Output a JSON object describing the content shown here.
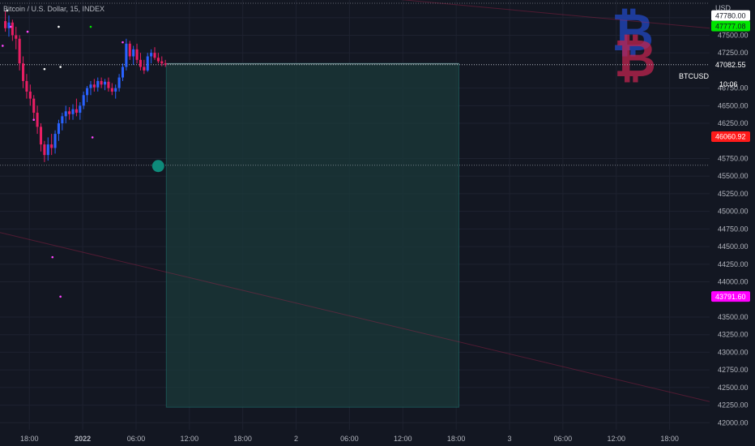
{
  "header": {
    "title": "Bitcoin / U.S. Dollar, 15, INDEX",
    "currency": "USD"
  },
  "chart_data": {
    "type": "candlestick",
    "symbol_label": "BTCUSD",
    "countdown": "10:06",
    "ylim": [
      41900,
      48000
    ],
    "y_ticks": [
      {
        "value": 47750,
        "label": "47750.00"
      },
      {
        "value": 47500,
        "label": "47500.00"
      },
      {
        "value": 47250,
        "label": "47250.00"
      },
      {
        "value": 46750,
        "label": "46750.00"
      },
      {
        "value": 46500,
        "label": "46500.00"
      },
      {
        "value": 46250,
        "label": "46250.00"
      },
      {
        "value": 45750,
        "label": "45750.00"
      },
      {
        "value": 45500,
        "label": "45500.00"
      },
      {
        "value": 45250,
        "label": "45250.00"
      },
      {
        "value": 45000,
        "label": "45000.00"
      },
      {
        "value": 44750,
        "label": "44750.00"
      },
      {
        "value": 44500,
        "label": "44500.00"
      },
      {
        "value": 44250,
        "label": "44250.00"
      },
      {
        "value": 44000,
        "label": "44000.00"
      },
      {
        "value": 43500,
        "label": "43500.00"
      },
      {
        "value": 43250,
        "label": "43250.00"
      },
      {
        "value": 43000,
        "label": "43000.00"
      },
      {
        "value": 42750,
        "label": "42750.00"
      },
      {
        "value": 42500,
        "label": "42500.00"
      },
      {
        "value": 42250,
        "label": "42250.00"
      },
      {
        "value": 42000,
        "label": "42000.00"
      }
    ],
    "x_ticks": [
      {
        "label": "18:00",
        "t": 0
      },
      {
        "label": "2022",
        "t": 6
      },
      {
        "label": "06:00",
        "t": 12
      },
      {
        "label": "12:00",
        "t": 18
      },
      {
        "label": "18:00",
        "t": 24
      },
      {
        "label": "2",
        "t": 30
      },
      {
        "label": "06:00",
        "t": 36
      },
      {
        "label": "12:00",
        "t": 42
      },
      {
        "label": "18:00",
        "t": 48
      },
      {
        "label": "3",
        "t": 54
      },
      {
        "label": "06:00",
        "t": 60
      },
      {
        "label": "12:00",
        "t": 66
      },
      {
        "label": "18:00",
        "t": 72
      }
    ],
    "x_domain": [
      -3.3,
      76.5
    ],
    "price_tags": [
      {
        "value": 47780.0,
        "label": "47780.00",
        "bg": "#ffffff",
        "fg": "#131722"
      },
      {
        "value": 47777.08,
        "label": "47777.08",
        "bg": "#00e600",
        "fg": "#131722"
      },
      {
        "value": 47082.55,
        "label": "47082.55",
        "bg": "#131722",
        "fg": "#ffffff"
      },
      {
        "value": 46060.92,
        "label": "46060.92",
        "bg": "#ff1a1a",
        "fg": "#ffffff"
      },
      {
        "value": 43791.6,
        "label": "43791.60",
        "bg": "#ff00ff",
        "fg": "#ffffff"
      }
    ],
    "last_price": 47082.55,
    "support_level": 45655,
    "projection_box": {
      "t_start": 15.4,
      "t_end": 48.3,
      "top": 47100,
      "bottom": 42220
    },
    "candles": [
      {
        "t": -2.7,
        "o": 47700,
        "h": 47850,
        "l": 47550,
        "c": 47600
      },
      {
        "t": -2.3,
        "o": 47600,
        "h": 47780,
        "l": 47480,
        "c": 47680
      },
      {
        "t": -1.9,
        "o": 47680,
        "h": 47720,
        "l": 47420,
        "c": 47500
      },
      {
        "t": -1.5,
        "o": 47500,
        "h": 47620,
        "l": 47300,
        "c": 47450
      },
      {
        "t": -1.1,
        "o": 47450,
        "h": 47500,
        "l": 47000,
        "c": 47100
      },
      {
        "t": -0.7,
        "o": 47100,
        "h": 47200,
        "l": 46750,
        "c": 46850
      },
      {
        "t": -0.3,
        "o": 46850,
        "h": 46950,
        "l": 46600,
        "c": 46700
      },
      {
        "t": 0.1,
        "o": 46700,
        "h": 46800,
        "l": 46500,
        "c": 46600
      },
      {
        "t": 0.5,
        "o": 46600,
        "h": 46650,
        "l": 46300,
        "c": 46400
      },
      {
        "t": 0.9,
        "o": 46400,
        "h": 46500,
        "l": 46100,
        "c": 46200
      },
      {
        "t": 1.3,
        "o": 46200,
        "h": 46250,
        "l": 45850,
        "c": 45950
      },
      {
        "t": 1.7,
        "o": 45950,
        "h": 46000,
        "l": 45700,
        "c": 45800
      },
      {
        "t": 2.1,
        "o": 45800,
        "h": 46050,
        "l": 45720,
        "c": 45950
      },
      {
        "t": 2.5,
        "o": 45950,
        "h": 46100,
        "l": 45800,
        "c": 45900
      },
      {
        "t": 2.9,
        "o": 45900,
        "h": 46150,
        "l": 45820,
        "c": 46100
      },
      {
        "t": 3.3,
        "o": 46100,
        "h": 46300,
        "l": 46000,
        "c": 46250
      },
      {
        "t": 3.7,
        "o": 46250,
        "h": 46400,
        "l": 46150,
        "c": 46350
      },
      {
        "t": 4.1,
        "o": 46350,
        "h": 46500,
        "l": 46250,
        "c": 46420
      },
      {
        "t": 4.5,
        "o": 46420,
        "h": 46480,
        "l": 46300,
        "c": 46380
      },
      {
        "t": 4.9,
        "o": 46380,
        "h": 46520,
        "l": 46300,
        "c": 46450
      },
      {
        "t": 5.3,
        "o": 46450,
        "h": 46600,
        "l": 46350,
        "c": 46400
      },
      {
        "t": 5.7,
        "o": 46400,
        "h": 46550,
        "l": 46300,
        "c": 46500
      },
      {
        "t": 6.1,
        "o": 46500,
        "h": 46700,
        "l": 46450,
        "c": 46650
      },
      {
        "t": 6.5,
        "o": 46650,
        "h": 46780,
        "l": 46550,
        "c": 46750
      },
      {
        "t": 6.9,
        "o": 46750,
        "h": 46850,
        "l": 46650,
        "c": 46800
      },
      {
        "t": 7.3,
        "o": 46800,
        "h": 46880,
        "l": 46700,
        "c": 46760
      },
      {
        "t": 7.7,
        "o": 46760,
        "h": 46900,
        "l": 46700,
        "c": 46850
      },
      {
        "t": 8.1,
        "o": 46850,
        "h": 46900,
        "l": 46750,
        "c": 46800
      },
      {
        "t": 8.5,
        "o": 46800,
        "h": 46880,
        "l": 46720,
        "c": 46840
      },
      {
        "t": 8.9,
        "o": 46840,
        "h": 46900,
        "l": 46700,
        "c": 46750
      },
      {
        "t": 9.3,
        "o": 46750,
        "h": 46820,
        "l": 46650,
        "c": 46700
      },
      {
        "t": 9.7,
        "o": 46700,
        "h": 46800,
        "l": 46600,
        "c": 46750
      },
      {
        "t": 10.1,
        "o": 46750,
        "h": 46950,
        "l": 46700,
        "c": 46900
      },
      {
        "t": 10.5,
        "o": 46900,
        "h": 47100,
        "l": 46850,
        "c": 47050
      },
      {
        "t": 10.9,
        "o": 47050,
        "h": 47450,
        "l": 47000,
        "c": 47380
      },
      {
        "t": 11.3,
        "o": 47380,
        "h": 47420,
        "l": 47150,
        "c": 47200
      },
      {
        "t": 11.7,
        "o": 47200,
        "h": 47350,
        "l": 47080,
        "c": 47300
      },
      {
        "t": 12.1,
        "o": 47300,
        "h": 47380,
        "l": 47100,
        "c": 47150
      },
      {
        "t": 12.5,
        "o": 47150,
        "h": 47250,
        "l": 47000,
        "c": 47050
      },
      {
        "t": 12.9,
        "o": 47050,
        "h": 47150,
        "l": 46950,
        "c": 47000
      },
      {
        "t": 13.3,
        "o": 47000,
        "h": 47250,
        "l": 46980,
        "c": 47200
      },
      {
        "t": 13.7,
        "o": 47200,
        "h": 47300,
        "l": 47100,
        "c": 47250
      },
      {
        "t": 14.1,
        "o": 47250,
        "h": 47330,
        "l": 47150,
        "c": 47180
      },
      {
        "t": 14.5,
        "o": 47180,
        "h": 47250,
        "l": 47100,
        "c": 47130
      },
      {
        "t": 14.9,
        "o": 47130,
        "h": 47200,
        "l": 47060,
        "c": 47100
      },
      {
        "t": 15.3,
        "o": 47100,
        "h": 47150,
        "l": 47050,
        "c": 47082
      }
    ],
    "markers": [
      {
        "t": -2.5,
        "v": 47850,
        "color": "#ffffff"
      },
      {
        "t": -2.1,
        "v": 47620,
        "color": "#ff44ff"
      },
      {
        "t": -0.2,
        "v": 47550,
        "color": "#ff44ff"
      },
      {
        "t": -3.0,
        "v": 47350,
        "color": "#ff44ff"
      },
      {
        "t": 3.3,
        "v": 47620,
        "color": "#ffffff"
      },
      {
        "t": 6.9,
        "v": 47620,
        "color": "#00e600"
      },
      {
        "t": 1.7,
        "v": 47020,
        "color": "#ffffff"
      },
      {
        "t": 3.5,
        "v": 47050,
        "color": "#ffffff"
      },
      {
        "t": 0.5,
        "v": 46300,
        "color": "#ff44ff"
      },
      {
        "t": 7.1,
        "v": 46050,
        "color": "#ff44ff"
      },
      {
        "t": 10.5,
        "v": 47400,
        "color": "#ff44ff"
      },
      {
        "t": 2.6,
        "v": 44350,
        "color": "#ff44ff"
      },
      {
        "t": 3.5,
        "v": 43790,
        "color": "#ff44ff"
      }
    ],
    "trend_lines": [
      {
        "t1": -3.3,
        "v1": 44700,
        "t2": 76.5,
        "v2": 42300
      },
      {
        "t1": 38,
        "v1": 48050,
        "t2": 76.5,
        "v2": 47600
      }
    ]
  },
  "colors": {
    "background": "#131722",
    "grid": "#1e2230",
    "candle_up": "#2962ff",
    "candle_down": "#e91e63",
    "box_fill": "#1b3a3a",
    "box_border": "#26a69a",
    "circle": "#0e8a7a",
    "logo_red": "#c0234f",
    "logo_blue": "#1f3fa8"
  },
  "logo": {
    "symbol": "₿",
    "icon": "bitcoin-logo-icon"
  }
}
